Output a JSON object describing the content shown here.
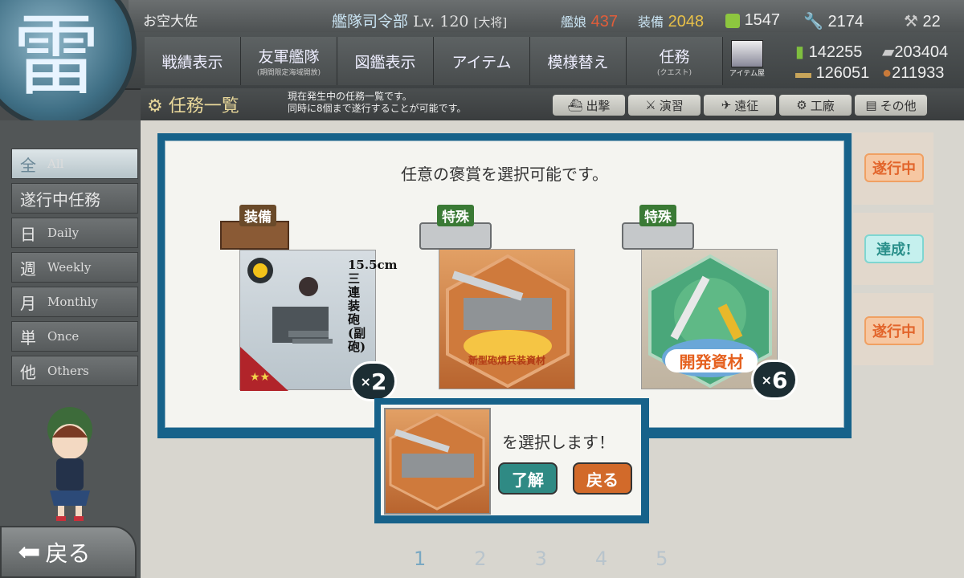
{
  "header": {
    "commander_name": "お空大佐",
    "hq_label": "艦隊司令部",
    "hq_level": "Lv. 120",
    "hq_rank": "[大将]",
    "ships_label": "艦娘",
    "ships_count": "437",
    "equip_label": "装備",
    "equip_count": "2048",
    "buckets": "1547",
    "dev_mats": "2174",
    "improve": "22"
  },
  "nav": {
    "items": [
      {
        "label": "戦績表示",
        "sub": ""
      },
      {
        "label": "友軍艦隊",
        "sub": "(期間限定海域開放)"
      },
      {
        "label": "図鑑表示",
        "sub": ""
      },
      {
        "label": "アイテム",
        "sub": ""
      },
      {
        "label": "模様替え",
        "sub": ""
      },
      {
        "label": "任務",
        "sub": "(クエスト)"
      }
    ],
    "item_shop": "アイテム屋"
  },
  "materials": {
    "fuel": "142255",
    "steel": "203404",
    "ammo": "126051",
    "bauxite": "211933"
  },
  "subheader": {
    "title": "任務一覧",
    "desc_line1": "現在発生中の任務一覧です。",
    "desc_line2": "同時に8個まで遂行することが可能です。",
    "tabs": [
      "出撃",
      "演習",
      "遠征",
      "工廠",
      "その他"
    ]
  },
  "sidebar": {
    "items": [
      {
        "jp": "全",
        "en": "All"
      },
      {
        "jp": "遂行中任務",
        "en": ""
      },
      {
        "jp": "日",
        "en": "Daily"
      },
      {
        "jp": "週",
        "en": "Weekly"
      },
      {
        "jp": "月",
        "en": "Monthly"
      },
      {
        "jp": "単",
        "en": "Once"
      },
      {
        "jp": "他",
        "en": "Others"
      }
    ],
    "back_label": "戻る"
  },
  "reward_panel": {
    "message": "任意の褒賞を選択可能です。",
    "rewards": [
      {
        "category": "装備",
        "name": "15.5cm三連装砲(副砲)",
        "count": "2"
      },
      {
        "category": "特殊",
        "name": "新型砲熕兵装資材",
        "count": ""
      },
      {
        "category": "特殊",
        "name": "開発資材",
        "count": "6"
      }
    ]
  },
  "status_tags": [
    "遂行中",
    "達成!",
    "遂行中"
  ],
  "confirm": {
    "text": "を選択します！",
    "ok": "了解",
    "back": "戻る"
  },
  "pagination": [
    "1",
    "2",
    "3",
    "4",
    "5"
  ],
  "colors": {
    "panel_border": "#16628a",
    "ok_button": "#2f8a84",
    "back_button": "#d26a2a",
    "tag_orange": "#f2a36a",
    "tag_teal": "#7fd6d1"
  }
}
